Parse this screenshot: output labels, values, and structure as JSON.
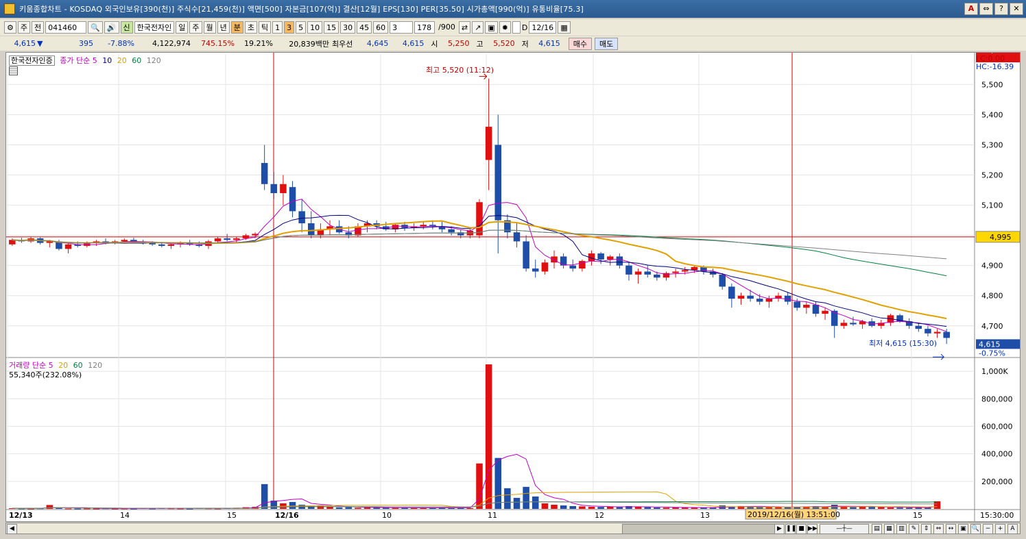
{
  "window": {
    "title": "키움종합차트 - KOSDAQ 외국인보유[390(천)] 주식수[21,459(천)] 액면[500] 자본금[107(억)] 결산[12월] EPS[130] PER[35.50] 시가총액[990(억)] 유통비율[75.3]",
    "ctrl_labels": [
      "A",
      "⇔",
      "?",
      "✕"
    ]
  },
  "toolbar": {
    "period_select": "주",
    "prev_label": "전",
    "code": "041460",
    "name": "한국전자인",
    "name_badge": "신",
    "intervals": [
      "일",
      "주",
      "월",
      "년",
      "분",
      "초",
      "틱"
    ],
    "interval_selected": "분",
    "minutes": [
      "1",
      "3",
      "5",
      "10",
      "15",
      "30",
      "45",
      "60"
    ],
    "minute_selected": "3",
    "custom_value": "3",
    "count": "178",
    "count_total": "/900",
    "date_input": "12/16",
    "checkbox_label": "D"
  },
  "quote": {
    "price": "4,615",
    "direction": "▼",
    "change": "395",
    "change_pct": "-7.88%",
    "volume": "4,122,974",
    "volume_ratio": "745.15%",
    "turnover": "19.21%",
    "amount": "20,839백만",
    "best_bid_label": "최우선",
    "best_bid_1": "4,645",
    "best_bid_2": "4,615",
    "open_label": "시",
    "open": "5,250",
    "high_label": "고",
    "high": "5,520",
    "low_label": "저",
    "low": "4,615",
    "buy_label": "매수",
    "sell_label": "매도"
  },
  "price_panel": {
    "stock_tag": "한국전자인증",
    "legend_prefix": "종가 단순",
    "ma_labels": [
      "5",
      "10",
      "20",
      "60",
      "120"
    ],
    "ma_colors": [
      "#c000c0",
      "#000080",
      "#e0a000",
      "#008040",
      "#808080"
    ],
    "lc_label": "LC:0.00",
    "hc_label": "HC:-16.39",
    "max_annotation": "최고 5,520 (11:12)",
    "min_annotation": "최저 4,615 (15:30)",
    "ref_price_label": "4,995",
    "last_price_label": "4,615",
    "last_pct_label": "-0.75%",
    "y_ticks": [
      "5,500",
      "5,400",
      "5,300",
      "5,200",
      "5,100",
      "5,000",
      "4,900",
      "4,800",
      "4,700"
    ]
  },
  "volume_panel": {
    "legend_prefix": "거래량 단순",
    "ma_labels": [
      "5",
      "20",
      "60",
      "120"
    ],
    "value_text": "55,340주(232.08%)",
    "last_volume_label": "55,340",
    "last_volume_pct": "232.08%",
    "y_ticks": [
      "1,000K",
      "800,000",
      "600,000",
      "400,000",
      "200,000"
    ]
  },
  "x_axis": {
    "labels": [
      "12/13",
      "14",
      "15",
      "12/16",
      "10",
      "11",
      "12",
      "13",
      "15"
    ],
    "crosshair_label": "2019/12/16(월) 13:51:00",
    "end_time": "15:30:00"
  },
  "chart_data": {
    "type": "candlestick",
    "title": "",
    "price_ylim": [
      4620,
      5560
    ],
    "volume_ylim": [
      0,
      1100000
    ],
    "reference_price": 4995,
    "high": {
      "value": 5520,
      "time": "11:12"
    },
    "low": {
      "value": 4615,
      "time": "15:30"
    },
    "ohlc": [
      [
        4970,
        4990,
        4965,
        4985
      ],
      [
        4985,
        4992,
        4975,
        4980
      ],
      [
        4980,
        4995,
        4975,
        4990
      ],
      [
        4990,
        4993,
        4970,
        4975
      ],
      [
        4975,
        4985,
        4960,
        4980
      ],
      [
        4980,
        4985,
        4950,
        4955
      ],
      [
        4955,
        4975,
        4940,
        4970
      ],
      [
        4970,
        4980,
        4960,
        4965
      ],
      [
        4965,
        4980,
        4960,
        4975
      ],
      [
        4975,
        4985,
        4965,
        4980
      ],
      [
        4980,
        4990,
        4970,
        4975
      ],
      [
        4975,
        4985,
        4970,
        4980
      ],
      [
        4980,
        4990,
        4975,
        4985
      ],
      [
        4985,
        4992,
        4975,
        4980
      ],
      [
        4980,
        4985,
        4970,
        4975
      ],
      [
        4975,
        4980,
        4965,
        4970
      ],
      [
        4970,
        4978,
        4960,
        4965
      ],
      [
        4965,
        4975,
        4955,
        4970
      ],
      [
        4970,
        4980,
        4960,
        4975
      ],
      [
        4975,
        4985,
        4965,
        4970
      ],
      [
        4970,
        4980,
        4960,
        4965
      ],
      [
        4965,
        4985,
        4955,
        4980
      ],
      [
        4980,
        4995,
        4975,
        4990
      ],
      [
        4990,
        5005,
        4980,
        4985
      ],
      [
        4985,
        4995,
        4975,
        4990
      ],
      [
        4990,
        5005,
        4985,
        5000
      ],
      [
        5000,
        5010,
        4990,
        5005
      ],
      [
        5240,
        5300,
        5150,
        5170
      ],
      [
        5170,
        5210,
        5120,
        5140
      ],
      [
        5140,
        5200,
        5100,
        5170
      ],
      [
        5160,
        5180,
        5060,
        5080
      ],
      [
        5080,
        5120,
        5010,
        5040
      ],
      [
        5040,
        5080,
        4990,
        5000
      ],
      [
        5000,
        5040,
        4990,
        5020
      ],
      [
        5020,
        5050,
        5000,
        5030
      ],
      [
        5030,
        5050,
        5005,
        5010
      ],
      [
        5010,
        5030,
        4990,
        5000
      ],
      [
        5000,
        5040,
        4995,
        5030
      ],
      [
        5030,
        5050,
        5010,
        5040
      ],
      [
        5040,
        5050,
        5020,
        5030
      ],
      [
        5030,
        5045,
        5015,
        5020
      ],
      [
        5020,
        5040,
        5010,
        5035
      ],
      [
        5035,
        5045,
        5015,
        5025
      ],
      [
        5025,
        5040,
        5015,
        5030
      ],
      [
        5030,
        5045,
        5020,
        5035
      ],
      [
        5035,
        5050,
        5020,
        5030
      ],
      [
        5030,
        5045,
        5010,
        5020
      ],
      [
        5020,
        5030,
        5000,
        5010
      ],
      [
        5010,
        5020,
        4990,
        5000
      ],
      [
        5000,
        5020,
        4990,
        5015
      ],
      [
        5000,
        5120,
        4990,
        5110
      ],
      [
        5250,
        5520,
        5150,
        5360
      ],
      [
        5300,
        5400,
        4940,
        5050
      ],
      [
        5050,
        5070,
        4990,
        5010
      ],
      [
        5010,
        5040,
        4960,
        4980
      ],
      [
        4980,
        5000,
        4880,
        4890
      ],
      [
        4890,
        4920,
        4860,
        4880
      ],
      [
        4880,
        4920,
        4870,
        4910
      ],
      [
        4910,
        4950,
        4890,
        4930
      ],
      [
        4930,
        4940,
        4890,
        4900
      ],
      [
        4900,
        4920,
        4880,
        4890
      ],
      [
        4890,
        4920,
        4880,
        4915
      ],
      [
        4915,
        4950,
        4900,
        4940
      ],
      [
        4940,
        4945,
        4905,
        4920
      ],
      [
        4920,
        4935,
        4900,
        4930
      ],
      [
        4930,
        4940,
        4890,
        4900
      ],
      [
        4900,
        4910,
        4850,
        4870
      ],
      [
        4870,
        4890,
        4840,
        4880
      ],
      [
        4880,
        4900,
        4860,
        4870
      ],
      [
        4870,
        4880,
        4850,
        4860
      ],
      [
        4860,
        4880,
        4850,
        4875
      ],
      [
        4875,
        4890,
        4860,
        4880
      ],
      [
        4880,
        4895,
        4870,
        4885
      ],
      [
        4885,
        4900,
        4875,
        4895
      ],
      [
        4895,
        4900,
        4870,
        4880
      ],
      [
        4880,
        4890,
        4860,
        4870
      ],
      [
        4870,
        4875,
        4820,
        4830
      ],
      [
        4830,
        4840,
        4760,
        4790
      ],
      [
        4790,
        4810,
        4770,
        4800
      ],
      [
        4800,
        4820,
        4780,
        4790
      ],
      [
        4790,
        4805,
        4770,
        4780
      ],
      [
        4780,
        4800,
        4760,
        4790
      ],
      [
        4790,
        4810,
        4780,
        4800
      ],
      [
        4800,
        4810,
        4770,
        4780
      ],
      [
        4780,
        4790,
        4750,
        4760
      ],
      [
        4760,
        4780,
        4740,
        4770
      ],
      [
        4770,
        4780,
        4730,
        4740
      ],
      [
        4740,
        4760,
        4720,
        4750
      ],
      [
        4750,
        4755,
        4660,
        4700
      ],
      [
        4700,
        4720,
        4690,
        4710
      ],
      [
        4710,
        4730,
        4700,
        4705
      ],
      [
        4705,
        4720,
        4690,
        4715
      ],
      [
        4715,
        4725,
        4695,
        4700
      ],
      [
        4700,
        4720,
        4690,
        4710
      ],
      [
        4710,
        4740,
        4700,
        4735
      ],
      [
        4735,
        4740,
        4710,
        4715
      ],
      [
        4715,
        4725,
        4690,
        4700
      ],
      [
        4700,
        4710,
        4680,
        4690
      ],
      [
        4690,
        4700,
        4665,
        4675
      ],
      [
        4675,
        4690,
        4660,
        4680
      ],
      [
        4680,
        4690,
        4640,
        4660
      ]
    ],
    "volume": [
      5000,
      3000,
      2000,
      4000,
      28000,
      6000,
      3000,
      2000,
      3000,
      2000,
      4000,
      2000,
      3000,
      2000,
      5000,
      3000,
      6000,
      4000,
      3000,
      2000,
      5000,
      4000,
      3000,
      6000,
      8000,
      12000,
      15000,
      180000,
      60000,
      40000,
      50000,
      30000,
      20000,
      25000,
      15000,
      10000,
      12000,
      8000,
      10000,
      9000,
      8000,
      7000,
      9000,
      6000,
      8000,
      7000,
      9000,
      6000,
      8000,
      6000,
      330000,
      1050000,
      370000,
      150000,
      80000,
      160000,
      90000,
      40000,
      30000,
      25000,
      20000,
      18000,
      15000,
      14000,
      16000,
      12000,
      20000,
      15000,
      12000,
      10000,
      9000,
      11000,
      10000,
      9000,
      8000,
      10000,
      25000,
      18000,
      20000,
      15000,
      12000,
      14000,
      16000,
      12000,
      15000,
      18000,
      20000,
      15000,
      30000,
      15000,
      12000,
      18000,
      14000,
      12000,
      10000,
      9000,
      8000,
      10000,
      9000,
      55340
    ],
    "ma_price": {
      "ma5": "computed",
      "ma10": "computed",
      "ma20": "computed",
      "ma60": "computed",
      "ma120": "computed"
    }
  }
}
